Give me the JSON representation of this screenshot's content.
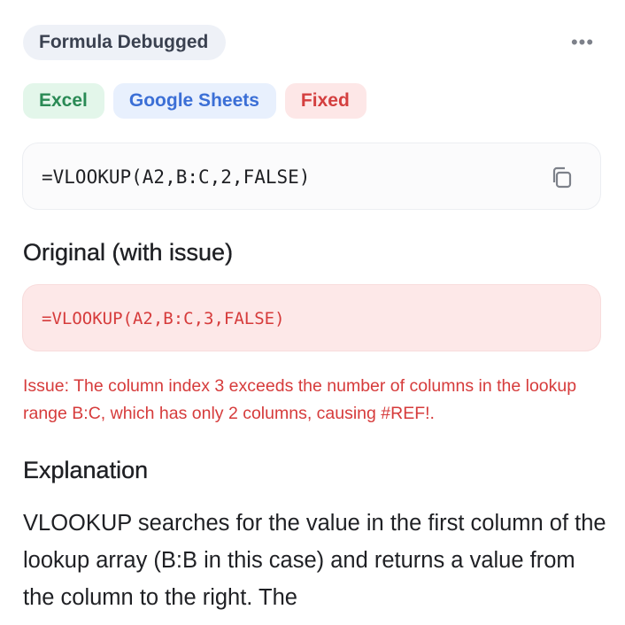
{
  "header": {
    "title": "Formula Debugged",
    "more_label": "•••"
  },
  "tags": [
    {
      "label": "Excel",
      "color": "#2a8a55"
    },
    {
      "label": "Google Sheets",
      "color": "#3b6fd6"
    },
    {
      "label": "Fixed",
      "color": "#d43f3f"
    }
  ],
  "fixed_formula": {
    "text": "=VLOOKUP(A2,B:C,2,FALSE)",
    "copy_icon": "copy-icon"
  },
  "original": {
    "heading": "Original (with issue)",
    "formula": "=VLOOKUP(A2,B:C,3,FALSE)",
    "issue": "Issue: The column index 3 exceeds the number of columns in the lookup range B:C, which has only 2 columns, causing #REF!."
  },
  "explanation": {
    "heading": "Explanation",
    "body": "VLOOKUP searches for the value in the first column of the lookup array (B:B in this case) and returns a value from the column to the right. The"
  }
}
